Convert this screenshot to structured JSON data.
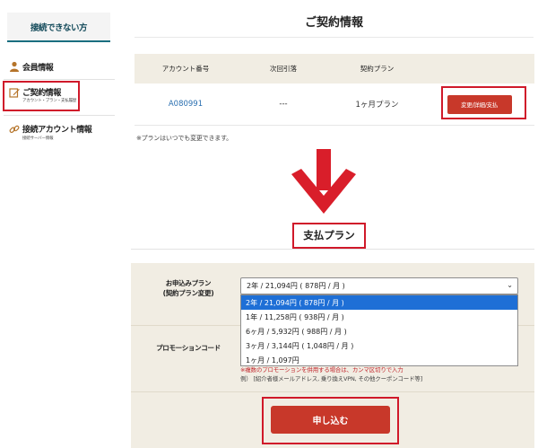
{
  "sidebar": {
    "connect_button": "接続できない方",
    "items": [
      {
        "label": "会員情報",
        "sub": "",
        "icon": "person-icon"
      },
      {
        "label": "ご契約情報",
        "sub": "アカウント・プラン・支払履歴",
        "icon": "edit-icon"
      },
      {
        "label": "接続アカウント情報",
        "sub": "接続サーバー情報",
        "icon": "link-icon"
      }
    ]
  },
  "contract": {
    "title": "ご契約情報",
    "headers": [
      "アカウント番号",
      "次回引落",
      "契約プラン"
    ],
    "row": {
      "account": "A080991",
      "next_withdrawal": "---",
      "plan": "1ヶ月プラン"
    },
    "change_button": "変更/詳細/支払",
    "note": "※プランはいつでも変更できます。"
  },
  "payment": {
    "title": "支払プラン",
    "plan_label_line1": "お申込みプラン",
    "plan_label_line2": "(契約プラン変更)",
    "selected_value": "2年 / 21,094円 ( 878円 / 月 )",
    "options": [
      "2年 / 21,094円 ( 878円 / 月 )",
      "1年 / 11,258円 ( 938円 / 月 )",
      "6ヶ月 / 5,932円 ( 988円 / 月 )",
      "3ヶ月 / 3,144円 ( 1,048円 / 月 )",
      "1ヶ月 / 1,097円"
    ],
    "promo_label": "プロモーションコード",
    "promo_note_line1": "※複数のプロモーションを併用する場合は、カンマ区切りで入力",
    "promo_note_line2": "例） [紹介者様メールアドレス, 乗り換えVPN, その他クーポンコード等]",
    "apply_button": "申し込む"
  },
  "colors": {
    "accent_red": "#c8382a",
    "highlight_border": "#d0192a",
    "panel_beige": "#f1ede3",
    "selection_blue": "#1e6fd6",
    "link_blue": "#2a6fb0"
  }
}
